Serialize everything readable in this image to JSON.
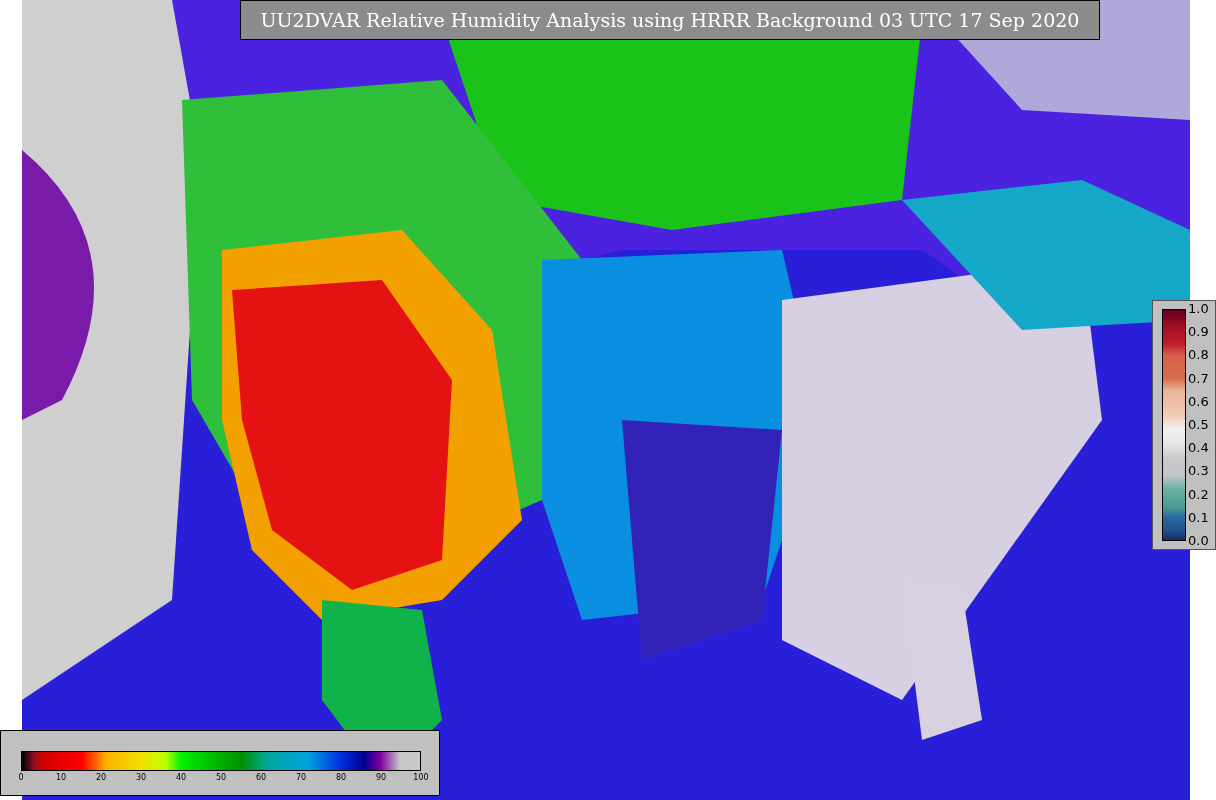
{
  "title": "UU2DVAR Relative Humidity Analysis using HRRR Background 03 UTC 17 Sep 2020",
  "humidity_colorbar": {
    "ticks": [
      "0",
      "10",
      "20",
      "30",
      "40",
      "50",
      "60",
      "70",
      "80",
      "90",
      "100"
    ]
  },
  "observation_colorbar": {
    "ticks": [
      "1.0",
      "0.9",
      "0.8",
      "0.7",
      "0.6",
      "0.5",
      "0.4",
      "0.3",
      "0.2",
      "0.1",
      "0.0"
    ]
  }
}
